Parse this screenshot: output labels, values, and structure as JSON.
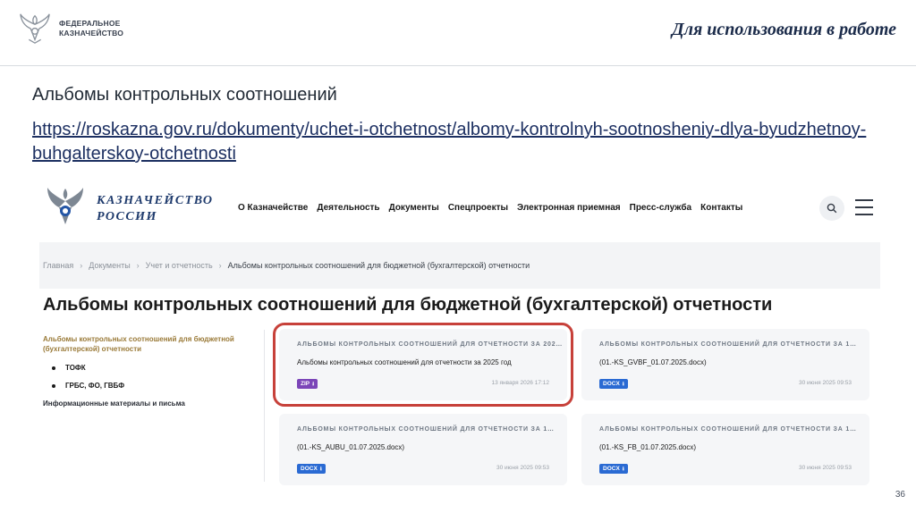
{
  "slide": {
    "logo_line1": "ФЕДЕРАЛЬНОЕ",
    "logo_line2": "КАЗНАЧЕЙСТВО",
    "tag": "Для использования в работе",
    "heading": "Альбомы контрольных соотношений",
    "link": "https://roskazna.gov.ru/dokumenty/uchet-i-otchetnost/albomy-kontrolnyh-sootnosheniy-dlya-byudzhetnoy-buhgalterskoy-otchetnosti",
    "page_number": "36"
  },
  "site": {
    "name_line1": "КАЗНАЧЕЙСТВО",
    "name_line2": "РОССИИ",
    "nav": [
      "О Казначействе",
      "Деятельность",
      "Документы",
      "Спецпроекты",
      "Электронная приемная",
      "Пресс-служба",
      "Контакты"
    ],
    "breadcrumb": [
      "Главная",
      "Документы",
      "Учет и отчетность",
      "Альбомы контрольных соотношений для бюджетной (бухгалтерской) отчетности"
    ],
    "page_title": "Альбомы контрольных соотношений для бюджетной (бухгалтерской) отчетности",
    "sidebar": {
      "active": "Альбомы контрольных соотношений для бюджетной (бухгалтерской) отчетности",
      "sub": [
        "ТОФК",
        "ГРБС, ФО, ГВБФ"
      ],
      "other": "Информационные материалы и письма"
    },
    "cards": [
      {
        "head": "АЛЬБОМЫ КОНТРОЛЬНЫХ СООТНОШЕНИЙ ДЛЯ ОТЧЕТНОСТИ ЗА 202…",
        "name": "Альбомы контрольных соотношений для отчетности за 2025 год",
        "badge": "ZIP",
        "date": "13 января 2026 17:12"
      },
      {
        "head": "АЛЬБОМЫ КОНТРОЛЬНЫХ СООТНОШЕНИЙ ДЛЯ ОТЧЕТНОСТИ ЗА 1…",
        "name": "(01.-KS_GVBF_01.07.2025.docx)",
        "badge": "DOCX",
        "date": "30 июня 2025 09:53"
      },
      {
        "head": "АЛЬБОМЫ КОНТРОЛЬНЫХ СООТНОШЕНИЙ ДЛЯ ОТЧЕТНОСТИ ЗА 1…",
        "name": "(01.-KS_AUBU_01.07.2025.docx)",
        "badge": "DOCX",
        "date": "30 июня 2025 09:53"
      },
      {
        "head": "АЛЬБОМЫ КОНТРОЛЬНЫХ СООТНОШЕНИЙ ДЛЯ ОТЧЕТНОСТИ ЗА 1…",
        "name": "(01.-KS_FB_01.07.2025.docx)",
        "badge": "DOCX",
        "date": "30 июня 2025 09:53"
      }
    ]
  },
  "colors": {
    "highlight": "#c7413a",
    "zip_badge": "#7b45b8",
    "docx_badge": "#2a6ad3",
    "sidebar_active": "#9a7a38"
  }
}
